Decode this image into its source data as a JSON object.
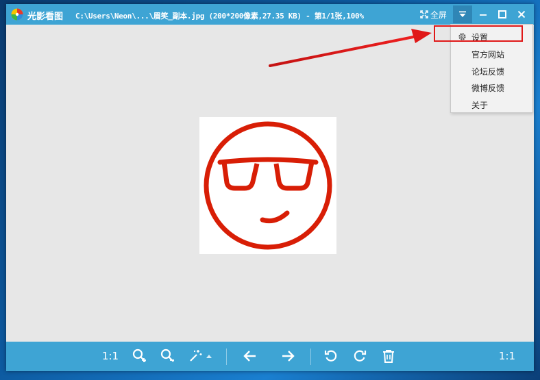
{
  "titlebar": {
    "app_name": "光影看图",
    "file_info": "C:\\Users\\Neon\\...\\眉笑_副本.jpg (200*200像素,27.35 KB) - 第1/1张,100%",
    "fullscreen_label": "全屏",
    "icons": [
      "app-logo-icon",
      "fullscreen-icon",
      "menu-dropdown-icon",
      "minimize-icon",
      "maximize-icon",
      "close-icon"
    ]
  },
  "menu": {
    "items": [
      {
        "label": "设置",
        "icon": "gear-icon"
      },
      {
        "label": "官方网站"
      },
      {
        "label": "论坛反馈"
      },
      {
        "label": "微博反馈"
      },
      {
        "label": "关于"
      }
    ]
  },
  "image": {
    "subject": "sunglasses-smiley-icon",
    "stroke_color": "#d81e06",
    "background": "#ffffff"
  },
  "toolbar": {
    "actual_size_label": "1:1",
    "zoom_readout": "1:1",
    "icons": [
      "zoom-in-icon",
      "zoom-out-icon",
      "magic-wand-icon",
      "caret-up-icon",
      "prev-arrow-icon",
      "next-arrow-icon",
      "rotate-left-icon",
      "rotate-right-icon",
      "delete-icon"
    ]
  },
  "colors": {
    "accent": "#3ea4d4",
    "annotation": "#e01818"
  }
}
